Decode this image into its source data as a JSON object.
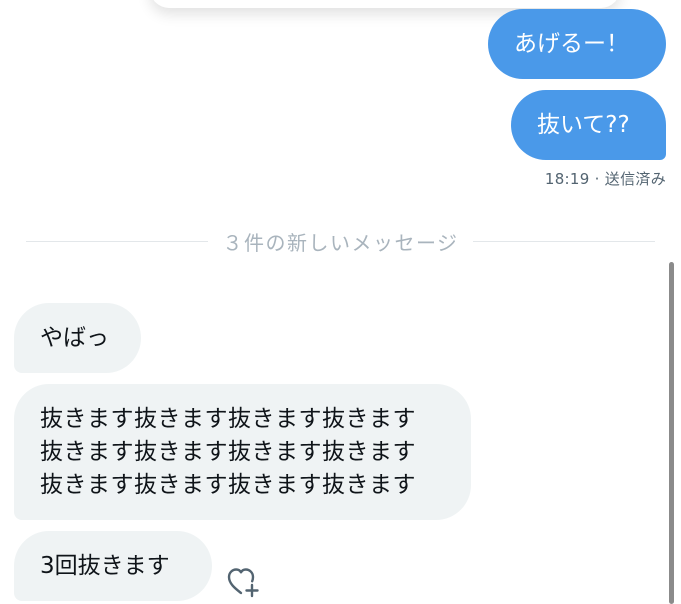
{
  "messages": {
    "sent": [
      {
        "text": "あげるー！"
      },
      {
        "text": "抜いて??"
      }
    ],
    "sent_meta": "18:19 · 送信済み",
    "new_divider": "３件の新しいメッセージ",
    "received": [
      {
        "text": "やばっ"
      },
      {
        "text": "抜きます抜きます抜きます抜きます\n抜きます抜きます抜きます抜きます\n抜きます抜きます抜きます抜きます"
      },
      {
        "text": "3回抜きます"
      }
    ]
  },
  "icons": {
    "react": "heart-plus-icon"
  },
  "colors": {
    "sent_bubble": "#4a99e9",
    "received_bubble": "#eff3f4",
    "meta_text": "#536471",
    "divider_text": "#a9b4bd"
  }
}
